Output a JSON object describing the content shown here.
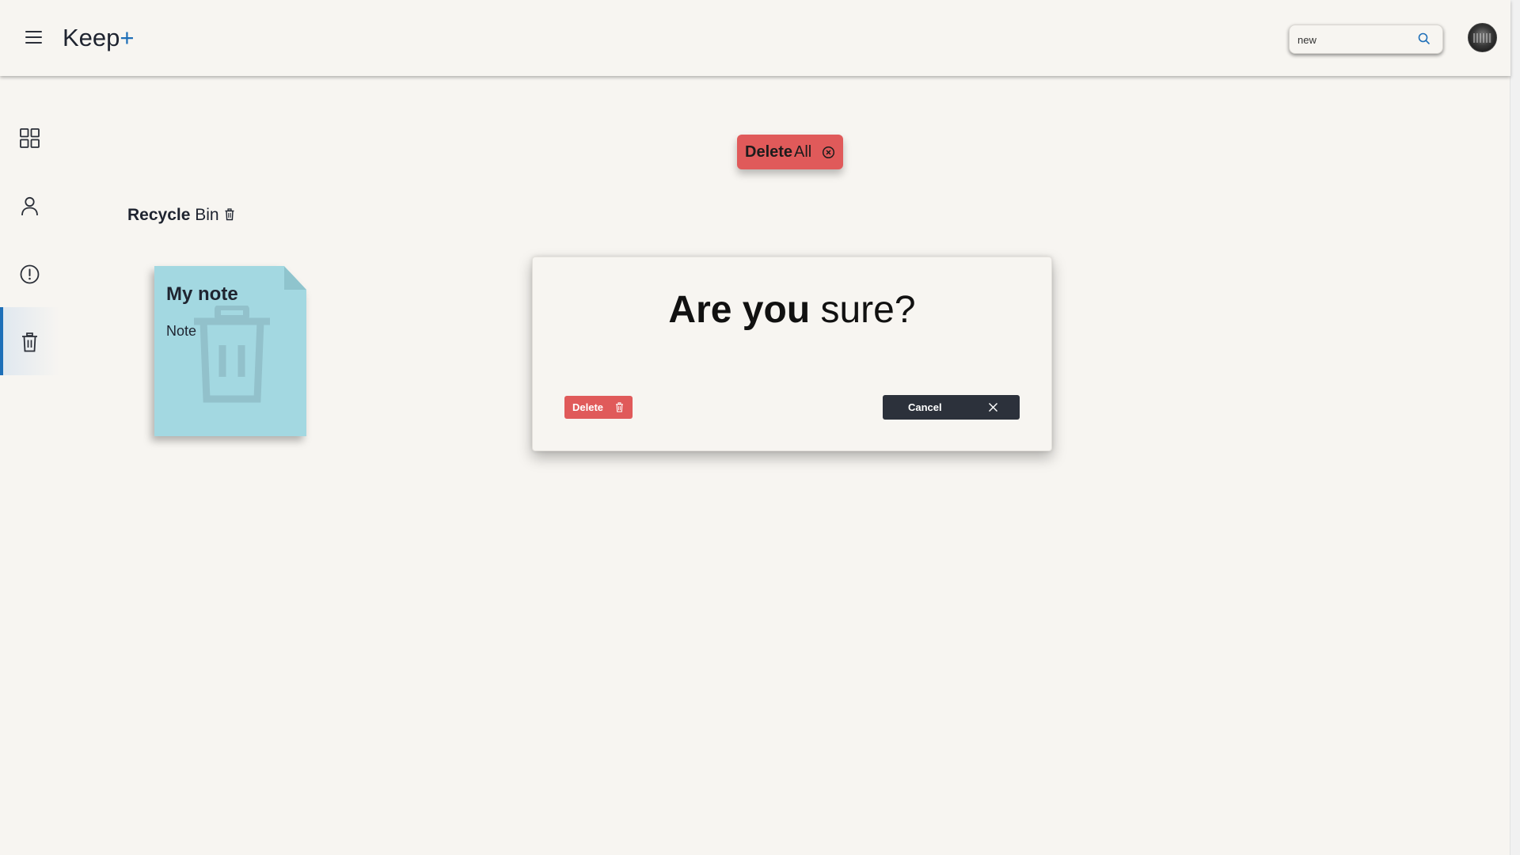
{
  "header": {
    "menu_icon": "hamburger-menu-icon",
    "brand_main": "Keep",
    "brand_plus": "+",
    "search": {
      "value": "new",
      "icon": "search-icon"
    },
    "avatar": "user-avatar"
  },
  "sidebar": {
    "items": [
      {
        "name": "notes",
        "icon": "grid-icon",
        "active": false
      },
      {
        "name": "profile",
        "icon": "user-icon",
        "active": false
      },
      {
        "name": "important",
        "icon": "alert-circle-icon",
        "active": false
      },
      {
        "name": "recycle-bin",
        "icon": "trash-icon",
        "active": true
      }
    ]
  },
  "toolbar": {
    "delete_all_bold": "Delete",
    "delete_all_rest": "All",
    "delete_all_icon": "close-circle-icon"
  },
  "section": {
    "title_bold": "Recycle",
    "title_rest": "Bin",
    "icon": "trash-icon"
  },
  "notes": [
    {
      "title": "My note",
      "body": "Note",
      "color": "#a3d8e1"
    }
  ],
  "dialog": {
    "title_bold": "Are you",
    "title_rest": "sure?",
    "delete_label": "Delete",
    "cancel_label": "Cancel"
  },
  "colors": {
    "background": "#f7f5f1",
    "accent": "#1e6fb8",
    "danger": "#e05a5a",
    "dark": "#2c313b"
  }
}
